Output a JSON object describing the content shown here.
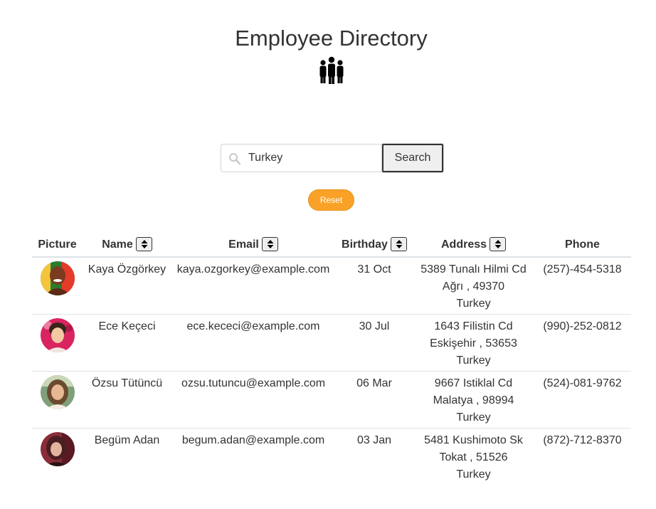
{
  "page": {
    "title": "Employee Directory",
    "header_icon": "people-group-icon"
  },
  "search": {
    "value": "Turkey",
    "button_label": "Search",
    "icon": "search-icon"
  },
  "reset": {
    "label": "Reset",
    "color": "#f9a227"
  },
  "table": {
    "headers": {
      "picture": "Picture",
      "name": "Name",
      "email": "Email",
      "birthday": "Birthday",
      "address": "Address",
      "phone": "Phone"
    },
    "rows": [
      {
        "name": "Kaya Özgörkey",
        "email": "kaya.ozgorkey@example.com",
        "birthday": "31 Oct",
        "address_line1": "5389 Tunalı Hilmi Cd",
        "address_line2": "Ağrı , 49370",
        "address_line3": "Turkey",
        "phone": "(257)-454-5318",
        "avatar_colors": [
          "#7a3b1f",
          "#2a7d2e",
          "#e53b2a"
        ]
      },
      {
        "name": "Ece Keçeci",
        "email": "ece.kececi@example.com",
        "birthday": "30 Jul",
        "address_line1": "1643 Filistin Cd",
        "address_line2": "Eskişehir , 53653",
        "address_line3": "Turkey",
        "phone": "(990)-252-0812",
        "avatar_colors": [
          "#d8245f",
          "#f3c9a4",
          "#3a2418"
        ]
      },
      {
        "name": "Özsu Tütüncü",
        "email": "ozsu.tutuncu@example.com",
        "birthday": "06 Mar",
        "address_line1": "9667 Istiklal Cd",
        "address_line2": "Malatya , 98994",
        "address_line3": "Turkey",
        "phone": "(524)-081-9762",
        "avatar_colors": [
          "#7fa07a",
          "#e6b894",
          "#6b4a2e"
        ]
      },
      {
        "name": "Begüm Adan",
        "email": "begum.adan@example.com",
        "birthday": "03 Jan",
        "address_line1": "5481 Kushimoto Sk",
        "address_line2": "Tokat , 51526",
        "address_line3": "Turkey",
        "phone": "(872)-712-8370",
        "avatar_colors": [
          "#8a2d3a",
          "#e3b5a0",
          "#4a1f22"
        ]
      }
    ]
  }
}
